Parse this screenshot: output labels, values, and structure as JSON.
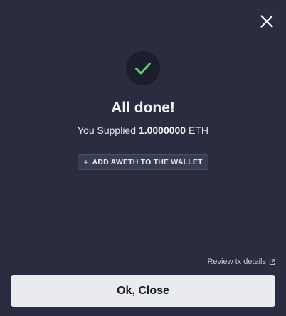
{
  "modal": {
    "title": "All done!",
    "subtitle_prefix": "You Supplied",
    "amount": "1.0000000",
    "token": "ETH",
    "add_token_label": "ADD AWETH TO THE WALLET",
    "review_link_label": "Review tx details",
    "confirm_label": "Ok, Close"
  },
  "icons": {
    "close": "close-icon",
    "success": "checkmark-icon",
    "add": "plus-icon",
    "external": "external-link-icon"
  },
  "colors": {
    "background": "#2a2d40",
    "success_green": "#66c97a",
    "check_circle_bg": "#1c1e2c",
    "button_light": "#eaebef"
  }
}
